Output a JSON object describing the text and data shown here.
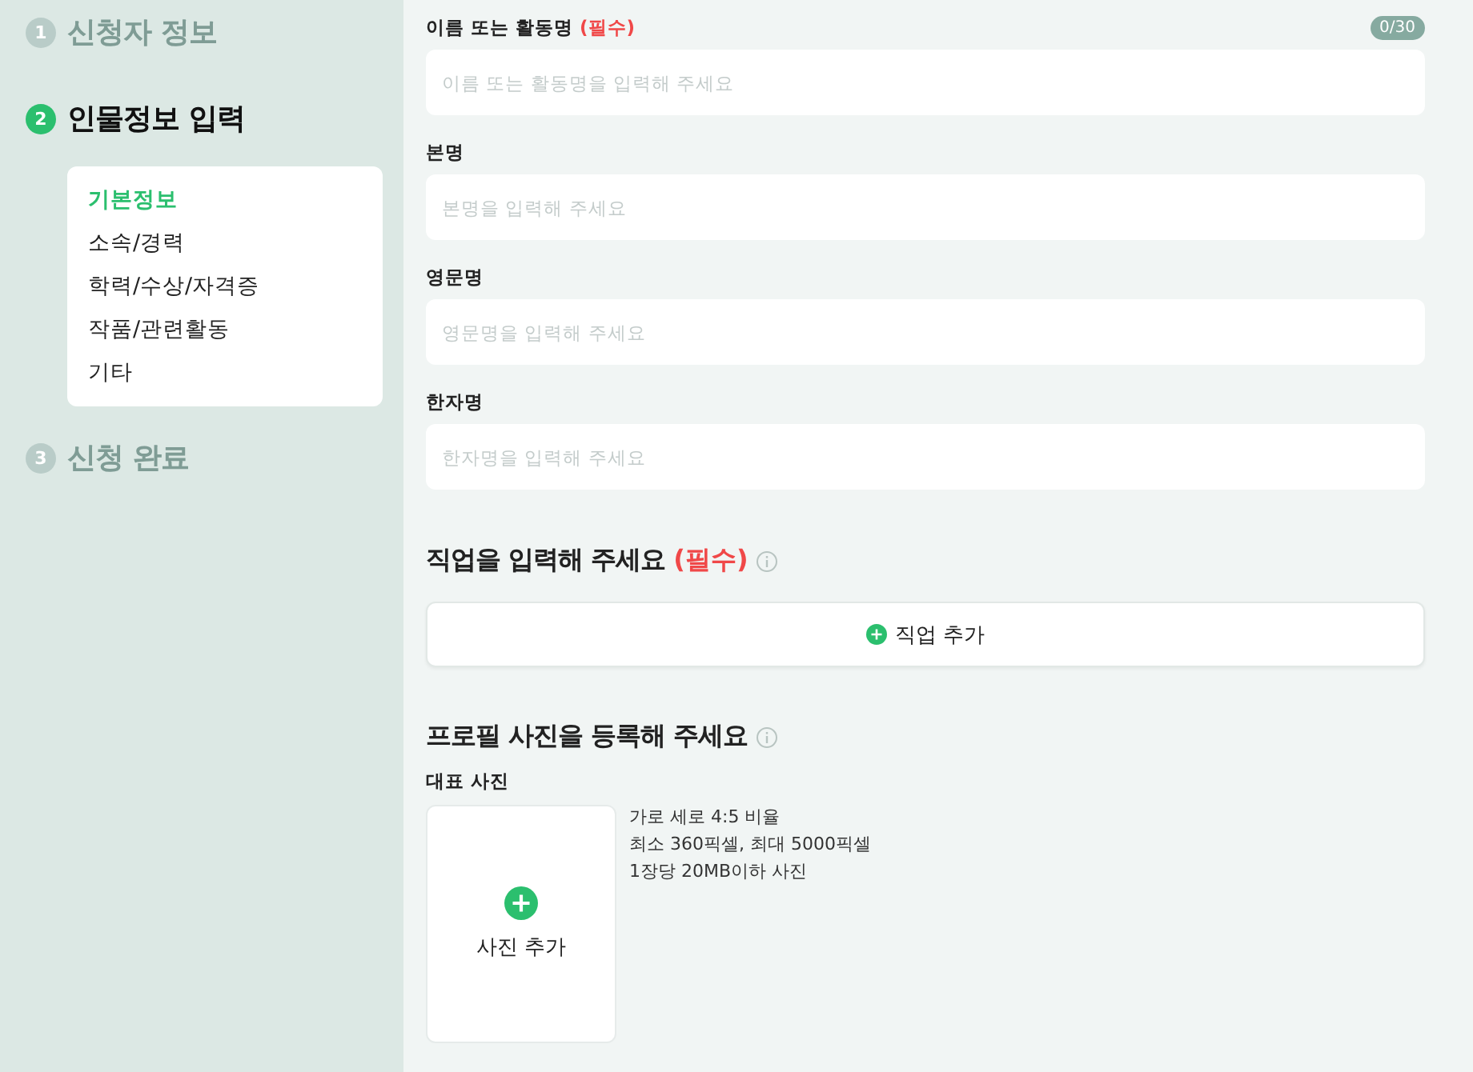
{
  "steps": [
    {
      "number": "1",
      "label": "신청자 정보",
      "active": false
    },
    {
      "number": "2",
      "label": "인물정보 입력",
      "active": true,
      "subitems": [
        {
          "label": "기본정보",
          "selected": true
        },
        {
          "label": "소속/경력",
          "selected": false
        },
        {
          "label": "학력/수상/자격증",
          "selected": false
        },
        {
          "label": "작품/관련활동",
          "selected": false
        },
        {
          "label": "기타",
          "selected": false
        }
      ]
    },
    {
      "number": "3",
      "label": "신청 완료",
      "active": false
    }
  ],
  "fields": [
    {
      "label": "이름 또는 활동명",
      "required_mark": "(필수)",
      "counter": "0/30",
      "placeholder": "이름 또는 활동명을 입력해 주세요"
    },
    {
      "label": "본명",
      "placeholder": "본명을 입력해 주세요"
    },
    {
      "label": "영문명",
      "placeholder": "영문명을 입력해 주세요"
    },
    {
      "label": "한자명",
      "placeholder": "한자명을 입력해 주세요"
    }
  ],
  "job_section": {
    "title": "직업을 입력해 주세요",
    "required_mark": "(필수)",
    "button": "직업 추가"
  },
  "photo_section": {
    "title": "프로필 사진을 등록해 주세요",
    "subtitle": "대표 사진",
    "button": "사진 추가",
    "notes": [
      "가로 세로 4:5 비율",
      "최소 360픽셀, 최대 5000픽셀",
      "1장당 20MB이하 사진"
    ]
  }
}
